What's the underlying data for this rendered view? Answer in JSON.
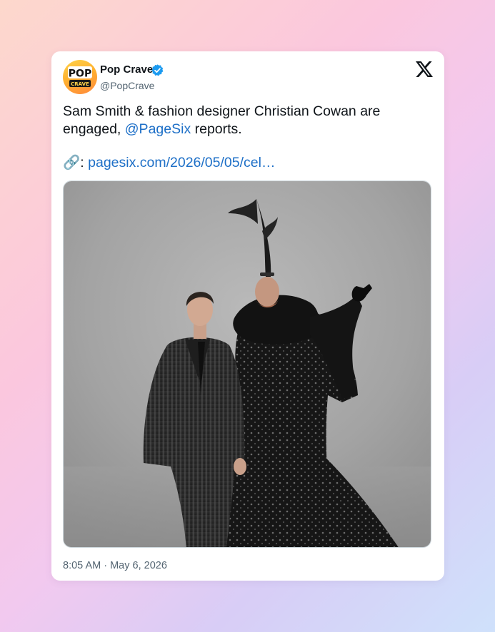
{
  "author": {
    "display_name": "Pop Crave",
    "handle": "@PopCrave",
    "verified": true,
    "avatar_text_top": "POP",
    "avatar_text_bottom": "CRAVE"
  },
  "tweet": {
    "text_before_mention": "Sam Smith & fashion designer Christian Cowan are engaged, ",
    "mention": "@PageSix",
    "text_after_mention": " reports.",
    "link_prefix": "🔗: ",
    "link_text": "pagesix.com/2026/05/05/cel…",
    "timestamp": "8:05 AM · May 6, 2026"
  },
  "media": {
    "alt": "Photo of two people posing in black outfits against a grey backdrop"
  },
  "icons": {
    "platform_logo": "x-logo-icon",
    "verified_badge": "verified-badge-icon",
    "link": "link-icon"
  },
  "colors": {
    "link": "#1d6fc7",
    "verified": "#1d9bf0",
    "text": "#0f1419",
    "secondary_text": "#536471"
  }
}
